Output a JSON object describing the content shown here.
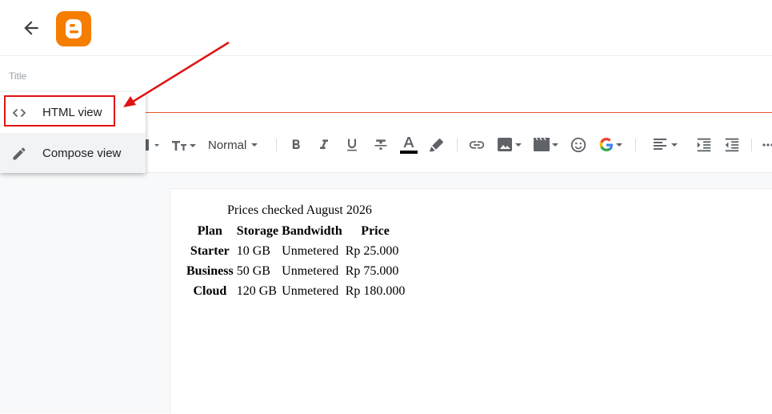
{
  "header": {
    "back_icon": "arrow-left-icon",
    "logo": "blogger-logo",
    "brand_color": "#f57d00"
  },
  "post": {
    "title_placeholder": "Title"
  },
  "view_menu": {
    "items": [
      {
        "label": "HTML view",
        "icon": "code-icon"
      },
      {
        "label": "Compose view",
        "icon": "pencil-icon"
      }
    ],
    "highlight_color": "#e11414"
  },
  "toolbar": {
    "paragraph_style": "Normal",
    "tools": [
      "heading-icon",
      "text-size-icon",
      "bold-icon",
      "italic-icon",
      "underline-icon",
      "strikethrough-icon",
      "text-color-icon",
      "highlight-icon",
      "link-icon",
      "image-icon",
      "video-icon",
      "emoji-icon",
      "google-icon",
      "align-left-icon",
      "indent-icon",
      "outdent-icon",
      "more-icon"
    ]
  },
  "content": {
    "caption": "Prices checked August 2026",
    "columns": [
      "Plan",
      "Storage",
      "Bandwidth",
      "Price"
    ],
    "rows": [
      {
        "plan": "Starter",
        "storage": "10 GB",
        "bandwidth": "Unmetered",
        "price": "Rp 25.000"
      },
      {
        "plan": "Business",
        "storage": "50 GB",
        "bandwidth": "Unmetered",
        "price": "Rp 75.000"
      },
      {
        "plan": "Cloud",
        "storage": "120 GB",
        "bandwidth": "Unmetered",
        "price": "Rp 180.000"
      }
    ]
  }
}
